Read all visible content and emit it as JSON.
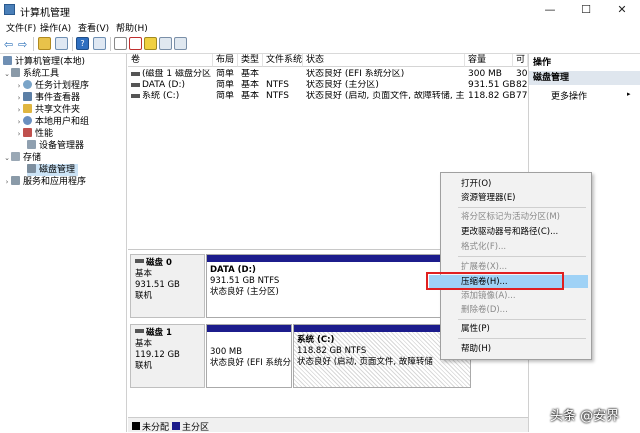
{
  "window": {
    "title": "计算机管理",
    "controls": {
      "minimize": "—",
      "maximize": "☐",
      "close": "✕"
    }
  },
  "menu": [
    "文件(F)",
    "操作(A)",
    "查看(V)",
    "帮助(H)"
  ],
  "tree": {
    "root": "计算机管理(本地)",
    "system_tools": "系统工具",
    "task_scheduler": "任务计划程序",
    "event_viewer": "事件查看器",
    "shared_folders": "共享文件夹",
    "local_users": "本地用户和组",
    "performance": "性能",
    "device_manager": "设备管理器",
    "storage": "存储",
    "disk_management": "磁盘管理",
    "services": "服务和应用程序"
  },
  "volume_list": {
    "headers": [
      "卷",
      "布局",
      "类型",
      "文件系统",
      "状态",
      "容量",
      "可"
    ],
    "rows": [
      {
        "volume": "(磁盘 1 磁盘分区 1)",
        "layout": "简单",
        "type": "基本",
        "fs": "",
        "status": "状态良好 (EFI 系统分区)",
        "capacity": "300 MB",
        "free": "30"
      },
      {
        "volume": "DATA (D:)",
        "layout": "简单",
        "type": "基本",
        "fs": "NTFS",
        "status": "状态良好 (主分区)",
        "capacity": "931.51 GB",
        "free": "82"
      },
      {
        "volume": "系统 (C:)",
        "layout": "简单",
        "type": "基本",
        "fs": "NTFS",
        "status": "状态良好 (启动, 页面文件, 故障转储, 主分区)",
        "capacity": "118.82 GB",
        "free": "77"
      }
    ]
  },
  "disks": [
    {
      "name": "磁盘 0",
      "kind": "基本",
      "size": "931.51 GB",
      "state": "联机",
      "partitions": [
        {
          "title": "DATA (D:)",
          "size": "931.51 GB NTFS",
          "status": "状态良好 (主分区)"
        }
      ]
    },
    {
      "name": "磁盘 1",
      "kind": "基本",
      "size": "119.12 GB",
      "state": "联机",
      "partitions": [
        {
          "title": "",
          "size": "300 MB",
          "status": "状态良好 (EFI 系统分区)"
        },
        {
          "title": "系统 (C:)",
          "size": "118.82 GB NTFS",
          "status": "状态良好 (启动, 页面文件, 故障转储"
        }
      ]
    }
  ],
  "legend": {
    "unallocated": "未分配",
    "primary": "主分区"
  },
  "actions": {
    "header": "操作",
    "section": "磁盘管理",
    "more": "更多操作"
  },
  "context_menu": {
    "open": "打开(O)",
    "explorer": "资源管理器(E)",
    "mark_active": "将分区标记为活动分区(M)",
    "change_letter": "更改驱动器号和路径(C)...",
    "format": "格式化(F)...",
    "extend": "扩展卷(X)...",
    "shrink": "压缩卷(H)...",
    "add_mirror": "添加镜像(A)...",
    "delete": "删除卷(D)...",
    "properties": "属性(P)",
    "help": "帮助(H)"
  },
  "watermark": "头条 @安界",
  "colors": {
    "primary_partition": "#1c1c8c",
    "unallocated": "#000000",
    "highlight": "#9fd2f6",
    "annotation": "#e02020"
  }
}
